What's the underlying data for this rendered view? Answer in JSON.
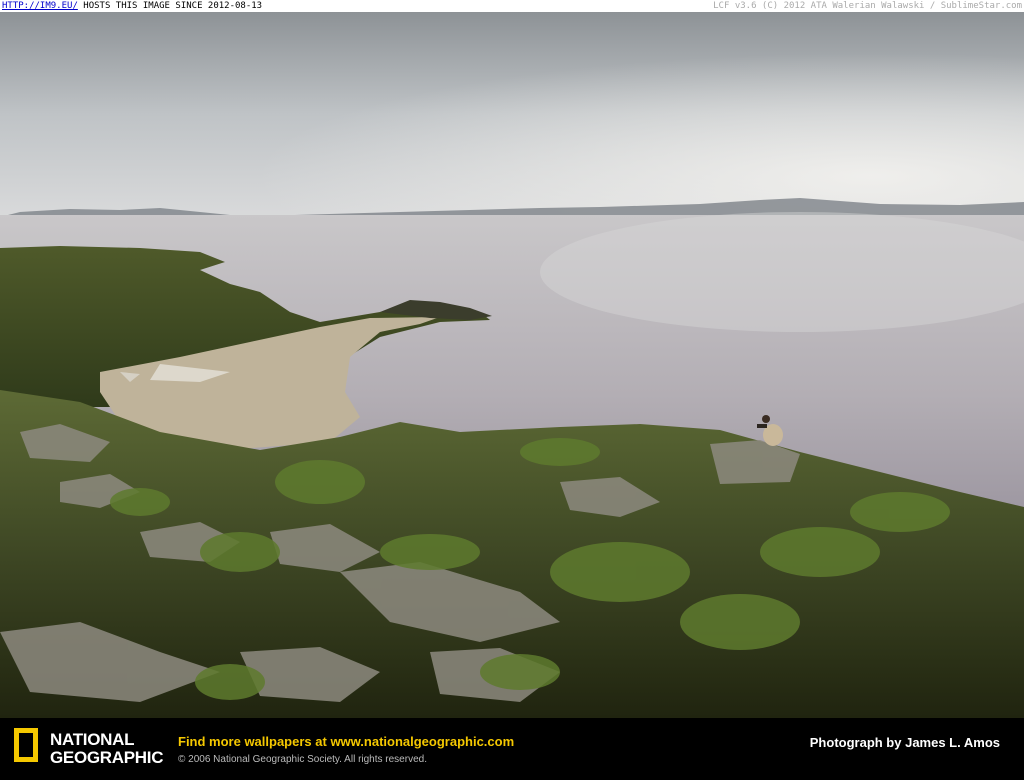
{
  "topbar": {
    "link_text": "HTTP://IM9.EU/",
    "hosts_text": "HOSTS THIS IMAGE SINCE 2012-08-13",
    "right_text": "LCF v3.6 (C) 2012 ATA Walerian Walawski / SublimeStar.com"
  },
  "footer": {
    "logo_line1": "NATIONAL",
    "logo_line2": "GEOGRAPHIC",
    "promo_prefix": "Find more wallpapers at ",
    "promo_url": "www.nationalgeographic.com",
    "copyright": "© 2006 National Geographic Society. All rights reserved.",
    "credit": "Photograph by James L. Amos",
    "logo_color": "#f5c800"
  },
  "photo": {
    "subject": "person-sitting-on-hillside"
  }
}
